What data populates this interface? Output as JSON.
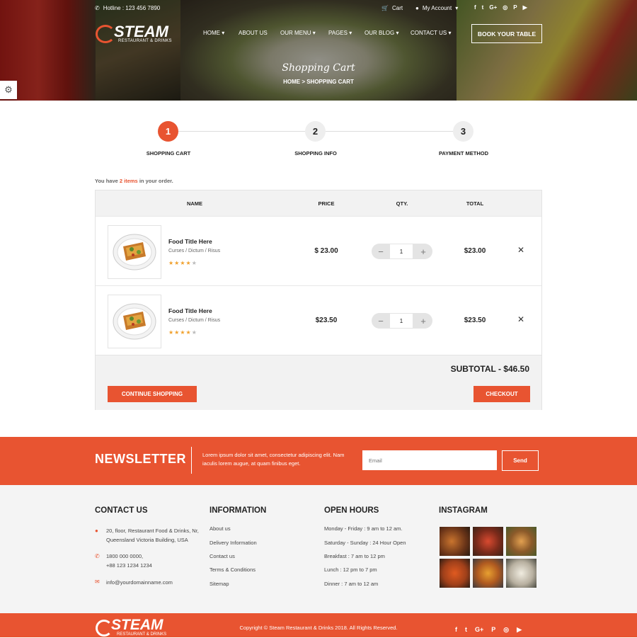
{
  "topbar": {
    "hotline": "Hotline : 123 456 7890",
    "cart": "Cart",
    "account": "My Account",
    "social": [
      "f",
      "t",
      "G+",
      "◎",
      "P",
      "▶"
    ]
  },
  "brand": {
    "name": "STEAM",
    "tagline": "RESTAURANT & DRINKS"
  },
  "nav": {
    "items": [
      "HOME",
      "ABOUT US",
      "OUR MENU",
      "PAGES",
      "OUR BLOG",
      "CONTACT US"
    ],
    "book": "BOOK YOUR TABLE"
  },
  "hero": {
    "title": "Shopping Cart",
    "breadcrumb": "HOME  >  SHOPPING CART"
  },
  "steps": [
    {
      "num": "1",
      "label": "SHOPPING CART"
    },
    {
      "num": "2",
      "label": "SHOPPING INFO"
    },
    {
      "num": "3",
      "label": "PAYMENT METHOD"
    }
  ],
  "summary": {
    "pre": "You have ",
    "count": "2 items",
    "post": " in your order."
  },
  "cart": {
    "headers": {
      "name": "NAME",
      "price": "PRICE",
      "qty": "QTY.",
      "total": "TOTAL"
    },
    "items": [
      {
        "title": "Food Title Here",
        "category": "Curses / Dictum / Risus",
        "rating": 4,
        "price": "$ 23.00",
        "qty": "1",
        "total": "$23.00"
      },
      {
        "title": "Food Title Here",
        "category": "Curses / Dictum / Risus",
        "rating": 4,
        "price": "$23.50",
        "qty": "1",
        "total": "$23.50"
      }
    ],
    "subtotal": "SUBTOTAL - $46.50",
    "continue": "CONTINUE SHOPPING",
    "checkout": "CHECKOUT"
  },
  "newsletter": {
    "title": "NEWSLETTER",
    "text": "Lorem ipsum dolor sit amet, consectetur adipiscing elit. Nam iaculis lorem augue, at quam finibus eget.",
    "placeholder": "Email",
    "send": "Send"
  },
  "footer": {
    "contact": {
      "title": "CONTACT US",
      "address": "20, floor, Restaurant Food & Drinks, Nr, Queensland Victoria Building, USA",
      "phone1": "1800 000 0000,",
      "phone2": "+88 123 1234 1234",
      "email": "info@yourdomainname.com"
    },
    "info": {
      "title": "INFORMATION",
      "links": [
        "About us",
        "Delivery Information",
        "Contact us",
        "Terms & Conditions",
        "Sitemap"
      ]
    },
    "hours": {
      "title": "OPEN HOURS",
      "lines": [
        "Monday - Friday : 9 am to 12 am.",
        "Saturday - Sunday : 24 Hour Open",
        "Breakfast : 7 am to 12 pm",
        "Lunch : 12 pm to 7 pm",
        "Dinner : 7 am to 12 am"
      ]
    },
    "instagram": {
      "title": "INSTAGRAM"
    }
  },
  "bottom": {
    "copyright": "Copyright © Steam Restaurant & Drinks 2018. All Rights Reserved.",
    "social": [
      "f",
      "t",
      "G+",
      "P",
      "◎",
      "▶"
    ]
  },
  "colors": {
    "accent": "#e85431",
    "star": "#f0a02c"
  }
}
